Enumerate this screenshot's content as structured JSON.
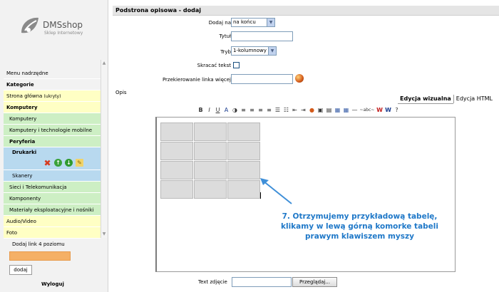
{
  "sidebar": {
    "logo": {
      "brand": "DMSshop",
      "tagline": "Sklep Internetowy",
      "icon": "leaf-logo-icon"
    },
    "menu": [
      {
        "label": "Menu nadrzędne",
        "style": "plain",
        "bold": false
      },
      {
        "label": "Kategorie",
        "style": "plain",
        "bold": true
      },
      {
        "label": "Strona główna",
        "extra": "(ukryty)",
        "style": "yellow",
        "bold": false
      },
      {
        "label": "Komputery",
        "style": "yellow",
        "bold": true
      },
      {
        "label": "Komputery",
        "style": "green",
        "bold": false,
        "indent": 1
      },
      {
        "label": "Komputery i technologie mobilne",
        "style": "green",
        "bold": false,
        "indent": 1
      },
      {
        "label": "Peryferia",
        "style": "green",
        "bold": true,
        "indent": 1
      },
      {
        "label": "Drukarki",
        "style": "blue",
        "bold": true,
        "indent": 2,
        "selected": true
      },
      {
        "label": "Skanery",
        "style": "blue",
        "bold": false,
        "indent": 2
      },
      {
        "label": "Sieci i Telekomunikacja",
        "style": "green",
        "bold": false,
        "indent": 1
      },
      {
        "label": "Komponenty",
        "style": "green",
        "bold": false,
        "indent": 1
      },
      {
        "label": "Materiały eksploatacyjne i nośniki",
        "style": "green",
        "bold": false,
        "indent": 1
      },
      {
        "label": "Audio/Video",
        "style": "yellow",
        "bold": false
      },
      {
        "label": "Foto",
        "style": "yellow",
        "bold": false
      }
    ],
    "add_link_label": "Dodaj link 4 poziomu",
    "add_button": "dodaj",
    "logout": "Wyloguj",
    "colors": {
      "yellow": "#ffffc4",
      "green": "#cdefc4",
      "blue": "#b8d9ef",
      "orange_input": "#f5b066"
    }
  },
  "main": {
    "header": "Podstrona opisowa - dodaj",
    "form": {
      "dodaj_na_label": "Dodaj na",
      "dodaj_na_value": "na końcu",
      "tytul_label": "Tytuł",
      "tytul_value": "",
      "tryb_label": "Tryb",
      "tryb_value": "1-kolumnowy",
      "skracac_label": "Skracać tekst",
      "skracac_checked": false,
      "przekierowanie_label": "Przekierowanie linka więcej",
      "przekierowanie_value": ""
    },
    "opis_label": "Opis",
    "tabs": [
      {
        "label": "Edycja wizualna",
        "active": true
      },
      {
        "label": "Edycja HTML",
        "active": false
      }
    ],
    "toolbar": [
      {
        "icon": "bold-icon",
        "glyph": "B"
      },
      {
        "icon": "italic-icon",
        "glyph": "I"
      },
      {
        "icon": "underline-icon",
        "glyph": "U"
      },
      {
        "icon": "font-color-icon",
        "glyph": "A"
      },
      {
        "icon": "highlight-icon",
        "glyph": "◑"
      },
      {
        "icon": "align-left-icon",
        "glyph": "≡"
      },
      {
        "icon": "align-center-icon",
        "glyph": "≡"
      },
      {
        "icon": "align-right-icon",
        "glyph": "≡"
      },
      {
        "icon": "align-justify-icon",
        "glyph": "≡"
      },
      {
        "icon": "bullet-list-icon",
        "glyph": "☰"
      },
      {
        "icon": "numbered-list-icon",
        "glyph": "☷"
      },
      {
        "icon": "outdent-icon",
        "glyph": "⇤"
      },
      {
        "icon": "indent-icon",
        "glyph": "⇥"
      },
      {
        "icon": "link-icon",
        "glyph": "●"
      },
      {
        "icon": "image-icon",
        "glyph": "▣"
      },
      {
        "icon": "media-icon",
        "glyph": "▤"
      },
      {
        "icon": "insert-table-icon",
        "glyph": "▦"
      },
      {
        "icon": "table-grid-icon",
        "glyph": "▦"
      },
      {
        "icon": "horizontal-rule-icon",
        "glyph": "—"
      },
      {
        "icon": "special-chars-icon",
        "glyph": "~abc~"
      },
      {
        "icon": "paste-word-icon",
        "glyph": "W"
      },
      {
        "icon": "clean-word-icon",
        "glyph": "W"
      },
      {
        "icon": "help-icon",
        "glyph": "?"
      }
    ],
    "editor_table": {
      "rows": 4,
      "cols": 3
    },
    "hint_text": "7. Otrzymujemy przykładową tabelę, klikamy w lewą górną komorke tabeli prawym klawiszem myszy",
    "photo_label": "Text zdjęcie",
    "browse_button": "Przeglądaj..."
  }
}
